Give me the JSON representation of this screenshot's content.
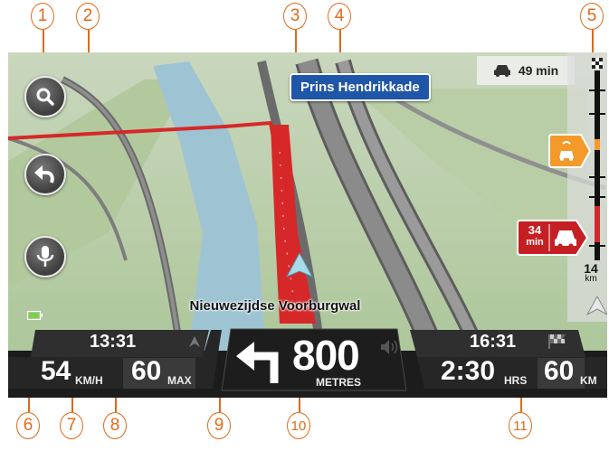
{
  "callouts": [
    "1",
    "2",
    "3",
    "4",
    "5",
    "6",
    "7",
    "8",
    "9",
    "10",
    "11"
  ],
  "street_sign": "Prins Hendrikkade",
  "current_street": "Nieuwezijdse Voorburgwal",
  "traffic_delay": {
    "time": "49 min"
  },
  "route_bar": {
    "delay_badge": {
      "value": "34",
      "unit": "min"
    },
    "distance": {
      "value": "14",
      "unit": "km"
    }
  },
  "left_panel": {
    "time": "13:31",
    "speed": "54",
    "speed_unit": "KM/H",
    "speed_limit": "60",
    "limit_label": "MAX"
  },
  "instruction": {
    "distance": "800",
    "unit": "METRES"
  },
  "right_panel": {
    "arrival_time": "16:31",
    "remaining_time": "2:30",
    "remaining_time_unit": "HRS",
    "remaining_distance": "60",
    "remaining_distance_unit": "KM"
  },
  "colors": {
    "route": "#d62828",
    "map_green": "#b6c9a3",
    "water": "#9ec4d4",
    "street_sign_blue": "#1f56a8",
    "callout_orange": "#e06a1a"
  }
}
